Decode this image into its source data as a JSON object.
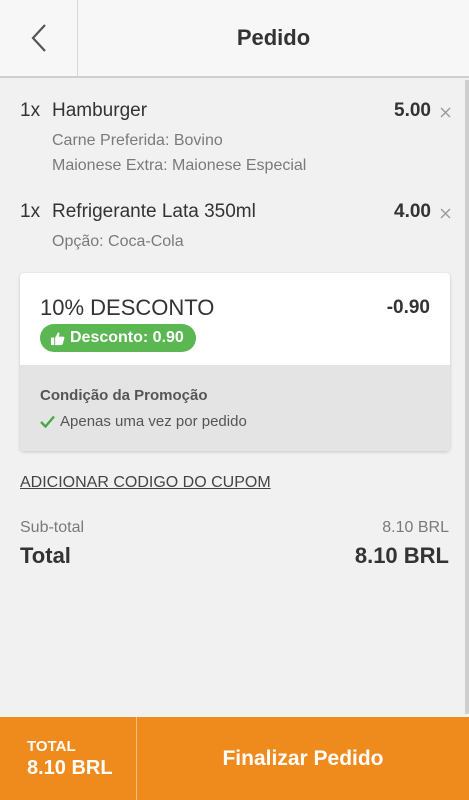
{
  "header": {
    "title": "Pedido"
  },
  "items": [
    {
      "qty": "1x",
      "name": "Hamburger",
      "price": "5.00",
      "options": [
        "Carne Preferida: Bovino",
        "Maionese Extra: Maionese Especial"
      ]
    },
    {
      "qty": "1x",
      "name": "Refrigerante Lata 350ml",
      "price": "4.00",
      "options": [
        "Opção: Coca-Cola"
      ]
    }
  ],
  "promo": {
    "title": "10% DESCONTO",
    "amount": "-0.90",
    "badge": "Desconto: 0.90",
    "condition_title": "Condição da Promoção",
    "condition_item": "Apenas uma vez por pedido"
  },
  "coupon_link": "ADICIONAR CODIGO DO CUPOM",
  "summary": {
    "subtotal_label": "Sub-total",
    "subtotal_value": "8.10 BRL",
    "total_label": "Total",
    "total_value": "8.10 BRL"
  },
  "footer": {
    "total_label": "TOTAL",
    "total_value": "8.10 BRL",
    "finalize_label": "Finalizar Pedido"
  },
  "colors": {
    "accent": "#ef8b1c",
    "badge": "#5bb752",
    "check": "#4aa844"
  }
}
